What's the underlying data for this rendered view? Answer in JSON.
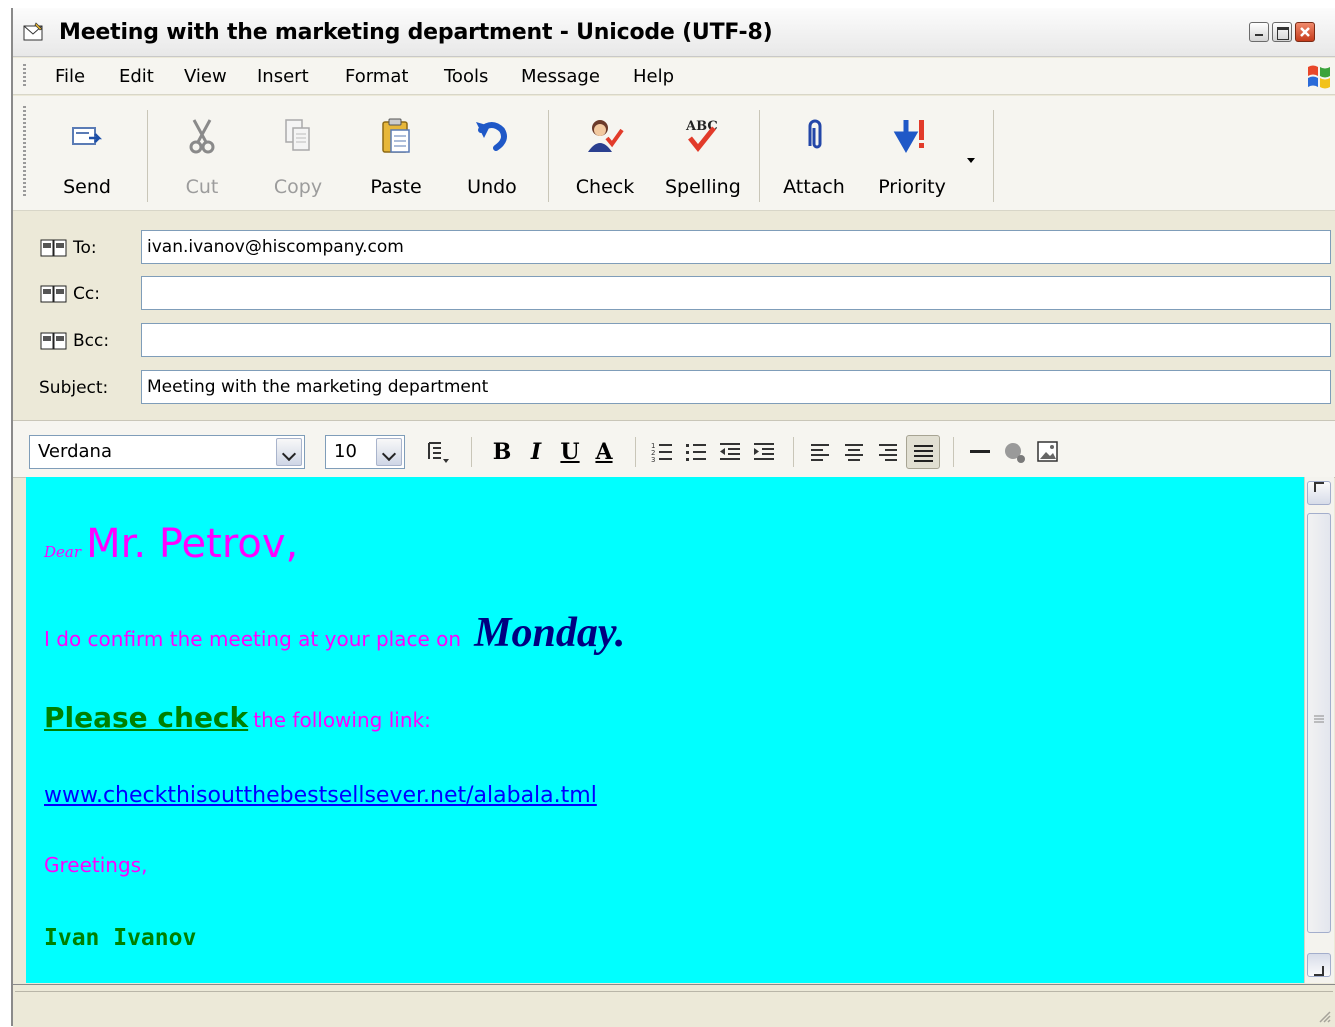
{
  "window": {
    "title": "Meeting with the marketing department - Unicode (UTF-8)"
  },
  "menu": [
    "File",
    "Edit",
    "View",
    "Insert",
    "Format",
    "Tools",
    "Message",
    "Help"
  ],
  "toolbar": {
    "send": "Send",
    "cut": "Cut",
    "copy": "Copy",
    "paste": "Paste",
    "undo": "Undo",
    "check": "Check",
    "spelling": "Spelling",
    "attach": "Attach",
    "priority": "Priority"
  },
  "header": {
    "to_label": "To:",
    "to_value": "ivan.ivanov@hiscompany.com",
    "cc_label": "Cc:",
    "cc_value": "",
    "bcc_label": "Bcc:",
    "bcc_value": "",
    "subject_label": "Subject:",
    "subject_value": "Meeting with the marketing department"
  },
  "format": {
    "font": "Verdana",
    "size": "10",
    "bold": "B",
    "italic": "I",
    "underline": "U",
    "color": "A"
  },
  "body": {
    "greeting_small": "Dear",
    "greeting_name": "Mr. Petrov,",
    "line1_text": "I do confirm the meeting at your place on",
    "line1_day": "Monday.",
    "line2_bold": "Please check",
    "line2_rest": "the following link:",
    "link": "www.checkthisoutthebestsellsever.net/alabala.tml",
    "closing": "Greetings,",
    "signature": "Ivan Ivanov"
  },
  "colors": {
    "editor_background": "#00ffff",
    "text_magenta": "#ff00ff",
    "day_navy": "#000080",
    "green": "#008000",
    "link_blue": "#0000ff"
  }
}
